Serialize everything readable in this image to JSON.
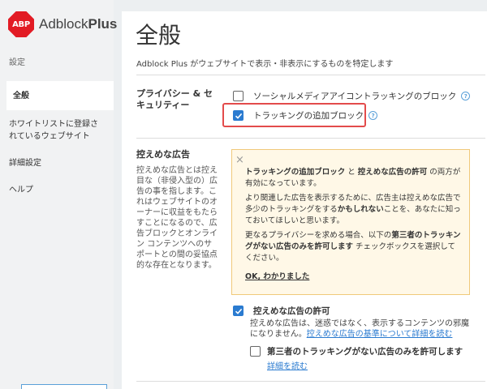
{
  "sidebar": {
    "logo_text": "ABP",
    "brand_regular": "Adblock",
    "brand_bold": "Plus",
    "section_label": "設定",
    "items": [
      {
        "label": "全般"
      },
      {
        "label": "ホワイトリストに登録されているウェブサイト"
      },
      {
        "label": "詳細設定"
      },
      {
        "label": "ヘルプ"
      }
    ]
  },
  "main": {
    "title": "全般",
    "subtitle": "Adblock Plus がウェブサイトで表示・非表示にするものを特定します",
    "privacy": {
      "title_line1": "プライバシー & セ",
      "title_line2": "キュリティー",
      "options": [
        {
          "label": "ソーシャルメディアアイコントラッキングのブロック",
          "checked": false,
          "help": "?"
        },
        {
          "label": "トラッキングの追加ブロック",
          "checked": true,
          "help": "?"
        }
      ]
    },
    "acceptable_ads": {
      "title": "控えめな広告",
      "description_lines": [
        "控えめな広告とは控え",
        "目な（非侵入型の）広",
        "告の事を指します。こ",
        "れはウェブサイトのオ",
        "ーナーに収益をもたら",
        "すことになるので、広",
        "告ブロックとオンライ",
        "ン コンテンツへのサ",
        "ポートとの間の妥協点",
        "的な存在となります。"
      ],
      "notice": {
        "close": "×",
        "p1_b1": "トラッキングの追加ブロック",
        "p1_t1": " と ",
        "p1_b2": "控えめな広告の許可",
        "p1_t2": " の両方が有効になっています。",
        "p2_t1": "より関連した広告を表示するために、広告主は控えめな広告で多少のトラッキングをする",
        "p2_b1": "かもしれない",
        "p2_t2": "ことを、あなたに知っておいてほしいと思います。",
        "p3_t1": "更なるプライバシーを求める場合、以下の",
        "p3_b1": "第三者のトラッキングがない広告のみを許可します",
        "p3_t2": " チェックボックスを選択してください。",
        "ok": "OK, わかりました"
      },
      "allow": {
        "label": "控えめな広告の許可",
        "checked": true,
        "desc_t1": "控えめな広告は、迷惑ではなく、表示するコンテンツの邪魔になりません。",
        "desc_link": "控えめな広告の基準について詳細を読む"
      },
      "no_tracking": {
        "label": "第三者のトラッキングがない広告のみを許可します",
        "checked": false,
        "link": "詳細を読む"
      }
    }
  },
  "colors": {
    "accent": "#2b7bd0",
    "highlight": "#e34b4b",
    "notice_bg": "#fff8e7",
    "brand_red": "#e21b24"
  }
}
